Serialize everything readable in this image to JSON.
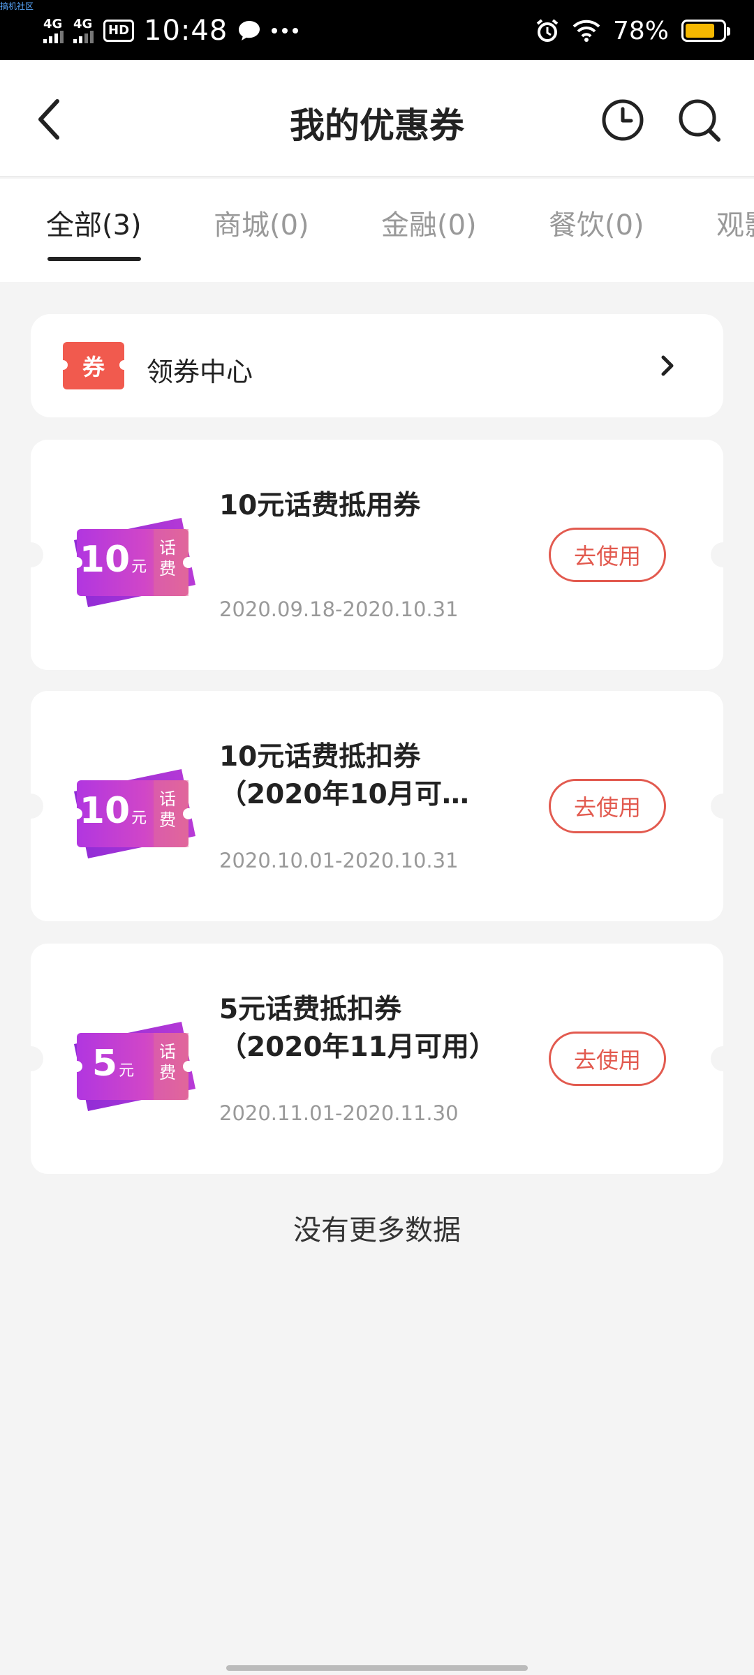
{
  "status_bar": {
    "corner_text": "搞机社区",
    "network_1": "4G",
    "network_2": "4G",
    "hd_label": "HD",
    "time": "10:48",
    "battery_percent": "78%",
    "battery_level": 0.78,
    "battery_color": "#f5b800"
  },
  "header": {
    "title": "我的优惠券",
    "icons": [
      "back-icon",
      "history-clock-icon",
      "search-icon"
    ]
  },
  "tabs": [
    {
      "label": "全部(3)",
      "active": true
    },
    {
      "label": "商城(0)",
      "active": false
    },
    {
      "label": "金融(0)",
      "active": false
    },
    {
      "label": "餐饮(0)",
      "active": false
    },
    {
      "label": "观影",
      "active": false
    }
  ],
  "coupon_center": {
    "badge": "券",
    "label": "领券中心",
    "badge_color": "#f15a4e"
  },
  "coupons": [
    {
      "amount": "10",
      "unit": "元",
      "type": "话费",
      "title_line1": "10元话费抵用券",
      "title_line2": "",
      "date_range": "2020.09.18-2020.10.31",
      "action": "去使用"
    },
    {
      "amount": "10",
      "unit": "元",
      "type": "话费",
      "title_line1": "10元话费抵扣券",
      "title_line2": "（2020年10月可…",
      "date_range": "2020.10.01-2020.10.31",
      "action": "去使用"
    },
    {
      "amount": "5",
      "unit": "元",
      "type": "话费",
      "title_line1": "5元话费抵扣券",
      "title_line2": "（2020年11月可用）",
      "date_range": "2020.11.01-2020.11.30",
      "action": "去使用"
    }
  ],
  "footer": {
    "no_more": "没有更多数据"
  },
  "colors": {
    "accent_red": "#e25a4f",
    "ticket_purple": "#a23ad8",
    "ticket_pink": "#e05aa6"
  }
}
